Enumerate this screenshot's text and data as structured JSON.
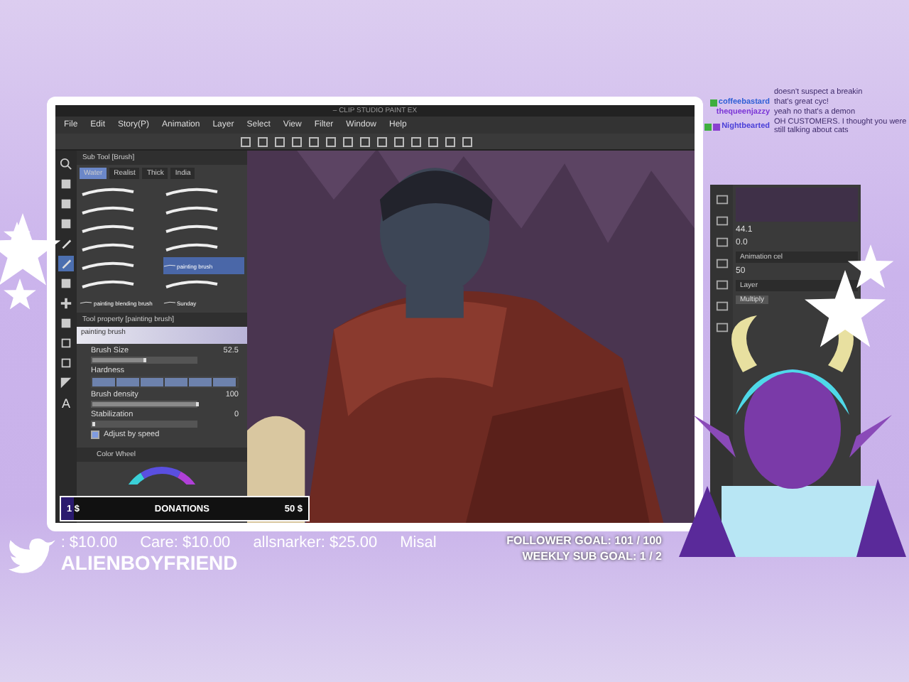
{
  "window": {
    "title": "– CLIP STUDIO PAINT EX"
  },
  "menu": [
    "File",
    "Edit",
    "Story(P)",
    "Animation",
    "Layer",
    "Select",
    "View",
    "Filter",
    "Window",
    "Help"
  ],
  "tools": [
    {
      "kind": "search",
      "selected": false
    },
    {
      "kind": "hand",
      "selected": false
    },
    {
      "kind": "zoom",
      "selected": false
    },
    {
      "kind": "move",
      "selected": false
    },
    {
      "kind": "pen",
      "selected": false
    },
    {
      "kind": "pen",
      "selected": true
    },
    {
      "kind": "fill",
      "selected": false
    },
    {
      "kind": "plus",
      "selected": false
    },
    {
      "kind": "fill",
      "selected": false
    },
    {
      "kind": "square",
      "selected": false
    },
    {
      "kind": "square",
      "selected": false
    },
    {
      "kind": "triangle",
      "selected": false
    },
    {
      "kind": "text",
      "label": "A",
      "selected": false
    }
  ],
  "subtool": {
    "title": "Sub Tool [Brush]",
    "tabs": [
      {
        "label": "Water",
        "selected": true
      },
      {
        "label": "Realist",
        "selected": false
      },
      {
        "label": "Thick",
        "selected": false
      },
      {
        "label": "India",
        "selected": false
      }
    ],
    "brushes": [
      {
        "selected": false
      },
      {
        "selected": false
      },
      {
        "selected": false
      },
      {
        "selected": false
      },
      {
        "selected": false
      },
      {
        "selected": false
      },
      {
        "selected": false
      },
      {
        "selected": false
      },
      {
        "selected": false
      },
      {
        "label": "painting brush",
        "selected": true
      },
      {
        "selected": false
      },
      {
        "selected": false
      },
      {
        "label": "painting blending brush",
        "selected": false
      },
      {
        "label": "Sunday",
        "selected": false
      }
    ]
  },
  "property": {
    "title": "Tool property [painting brush]",
    "preview": "painting brush",
    "rows": [
      {
        "kind": "slider",
        "label": "Brush Size",
        "value": "52.5",
        "level": 0.5
      },
      {
        "kind": "segments",
        "label": "Hardness",
        "level": 1
      },
      {
        "kind": "slider",
        "label": "Brush density",
        "value": "100",
        "level": 1
      },
      {
        "kind": "slider",
        "label": "Stabilization",
        "value": "0",
        "level": 0
      },
      {
        "kind": "checkbox",
        "label": "Adjust by speed",
        "checked": true
      }
    ]
  },
  "color_panel": {
    "tab": "Color Wheel"
  },
  "donations": {
    "min": "1 $",
    "label": "DONATIONS",
    "max": "50 $",
    "level": 0.05
  },
  "chat": [
    {
      "text": "doesn't suspect a breakin"
    },
    {
      "user": "coffeebastard",
      "color": "#2f5fd6",
      "text": "that's great cyc!",
      "badges": [
        {
          "color": "#3fae3f"
        }
      ]
    },
    {
      "user": "thequeenjazzy",
      "color": "#7b35d6",
      "text": "yeah no that's a demon"
    },
    {
      "user": "Nightbearted",
      "color": "#4a3fd8",
      "text": "OH CUSTOMERS. I thought you were still talking about cats",
      "badges": [
        {
          "color": "#3fae3f"
        },
        {
          "color": "#8a3fd0"
        }
      ]
    }
  ],
  "side_panel": {
    "readouts": [
      "44.1",
      "0.0"
    ],
    "cel_tab": "Animation cel",
    "opacity": "50",
    "layer_tab": "Layer",
    "blend": "Multiply"
  },
  "ticker": [
    ": $10.00",
    "Care: $10.00",
    "allsnarker: $25.00",
    "Misal"
  ],
  "twitter": "ALIENBOYFRIEND",
  "goals": [
    "FOLLOWER GOAL: 101 / 100",
    "WEEKLY SUB GOAL: 1 / 2"
  ]
}
